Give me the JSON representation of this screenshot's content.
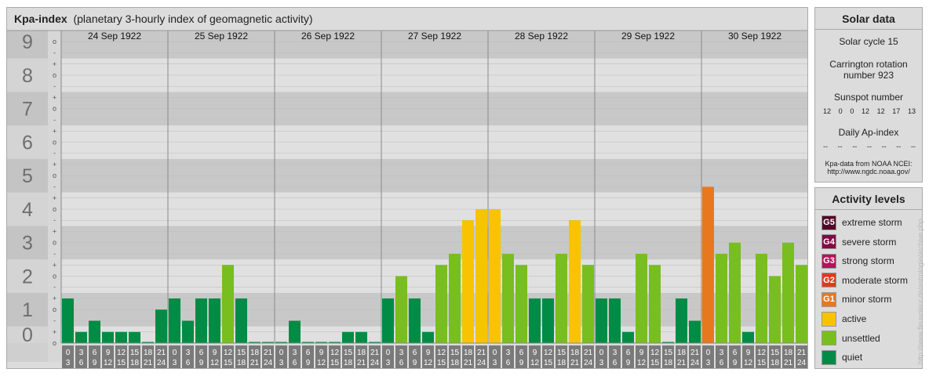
{
  "main": {
    "title_bold": "Kpa-index",
    "title_rest": "(planetary 3-hourly index of geomagnetic activity)"
  },
  "chart_data": {
    "type": "bar",
    "title": "Kpa-index (planetary 3-hourly index of geomagnetic activity)",
    "y_ticks": [
      "0",
      "1",
      "2",
      "3",
      "4",
      "5",
      "6",
      "7",
      "8",
      "9"
    ],
    "y_minor": [
      "-",
      "o",
      "+"
    ],
    "ylim": [
      0,
      9.333
    ],
    "days": [
      "24 Sep 1922",
      "25 Sep 1922",
      "26 Sep 1922",
      "27 Sep 1922",
      "28 Sep 1922",
      "29 Sep 1922",
      "30 Sep 1922"
    ],
    "interval_top": [
      "0",
      "3",
      "6",
      "9",
      "12",
      "15",
      "18",
      "21"
    ],
    "interval_bottom": [
      "3",
      "6",
      "9",
      "12",
      "15",
      "18",
      "21",
      "24"
    ],
    "values": [
      [
        1.333,
        0.333,
        0.667,
        0.333,
        0.333,
        0.333,
        0,
        1.0
      ],
      [
        1.333,
        0.667,
        1.333,
        1.333,
        2.333,
        1.333,
        0,
        0
      ],
      [
        0,
        0.667,
        0,
        0,
        0,
        0.333,
        0.333,
        0
      ],
      [
        1.333,
        2.0,
        1.333,
        0.333,
        2.333,
        2.667,
        3.667,
        4.0
      ],
      [
        4.0,
        2.667,
        2.333,
        1.333,
        1.333,
        2.667,
        3.667,
        2.333
      ],
      [
        1.333,
        1.333,
        0.333,
        2.667,
        2.333,
        0,
        1.333,
        0.667
      ],
      [
        4.667,
        2.667,
        3.0,
        0.333,
        2.667,
        2.0,
        3.0,
        2.333
      ]
    ],
    "colors": {
      "quiet": "#008c44",
      "unsettled": "#78be1e",
      "active": "#f8c300",
      "G1": "#e8781e",
      "G2": "#dc3c1e",
      "G3": "#b4145a",
      "G4": "#820a46",
      "G5": "#500a28"
    }
  },
  "solar": {
    "title": "Solar data",
    "cycle": "Solar cycle 15",
    "carrington_line1": "Carrington rotation",
    "carrington_line2": "number 923",
    "sunspot_label": "Sunspot number",
    "sunspot_values": [
      "12",
      "0",
      "0",
      "12",
      "12",
      "17",
      "13"
    ],
    "ap_label": "Daily Ap-index",
    "ap_values": [
      "--",
      "--",
      "--",
      "--",
      "--",
      "--",
      "--"
    ],
    "source_line1": "Kpa-data from NOAA NCEI:",
    "source_line2": "http://www.ngdc.noaa.gov/"
  },
  "activity": {
    "title": "Activity levels",
    "items": [
      {
        "code": "G5",
        "label": "extreme storm",
        "color": "#500a28"
      },
      {
        "code": "G4",
        "label": "severe storm",
        "color": "#820a46"
      },
      {
        "code": "G3",
        "label": "strong storm",
        "color": "#b4145a"
      },
      {
        "code": "G2",
        "label": "moderate storm",
        "color": "#dc3c1e"
      },
      {
        "code": "G1",
        "label": "minor storm",
        "color": "#e8781e"
      },
      {
        "code": "",
        "label": "active",
        "color": "#f8c300"
      },
      {
        "code": "",
        "label": "unsettled",
        "color": "#78be1e"
      },
      {
        "code": "",
        "label": "quiet",
        "color": "#008c44"
      }
    ]
  },
  "watermark": "http://www.fleuvoleur.de/astrologie/archive.php"
}
